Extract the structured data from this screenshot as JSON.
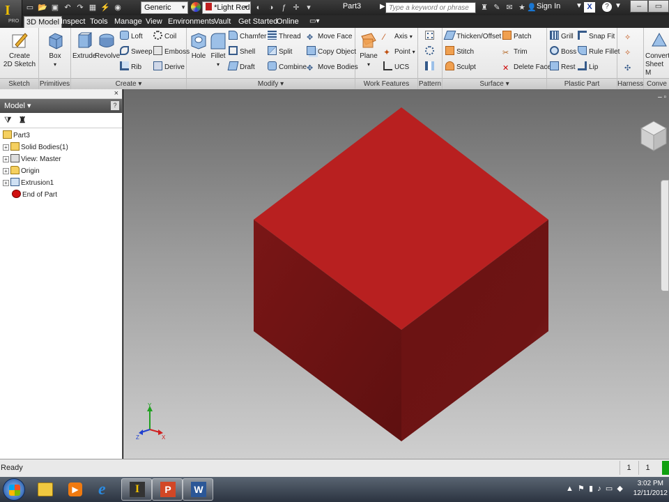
{
  "titlebar": {
    "app_logo": "I",
    "edition": "PRO",
    "material": "Generic",
    "appearance": "*Light Red",
    "document_title": "Part3",
    "search_placeholder": "Type a keyword or phrase",
    "sign_in": "Sign In",
    "help": "?"
  },
  "tabs": [
    "3D Model",
    "Inspect",
    "Tools",
    "Manage",
    "View",
    "Environments",
    "Vault",
    "Get Started",
    "Online"
  ],
  "ribbon": {
    "sketch": {
      "label": "Sketch",
      "create_2d_sketch_line1": "Create",
      "create_2d_sketch_line2": "2D Sketch"
    },
    "primitives": {
      "label": "Primitives",
      "box": "Box"
    },
    "create": {
      "label": "Create ▾",
      "extrude": "Extrude",
      "revolve": "Revolve",
      "loft": "Loft",
      "sweep": "Sweep",
      "rib": "Rib",
      "coil": "Coil",
      "emboss": "Emboss",
      "derive": "Derive"
    },
    "modify": {
      "label": "Modify ▾",
      "hole": "Hole",
      "fillet": "Fillet",
      "chamfer": "Chamfer",
      "shell": "Shell",
      "draft": "Draft",
      "thread": "Thread",
      "split": "Split",
      "combine": "Combine",
      "move_face": "Move Face",
      "copy_object": "Copy Object",
      "move_bodies": "Move Bodies"
    },
    "work_features": {
      "label": "Work Features",
      "plane": "Plane",
      "axis": "Axis",
      "point": "Point",
      "ucs": "UCS"
    },
    "pattern": {
      "label": "Pattern"
    },
    "surface": {
      "label": "Surface ▾",
      "thicken_offset": "Thicken/Offset",
      "stitch": "Stitch",
      "sculpt": "Sculpt",
      "patch": "Patch",
      "trim": "Trim",
      "delete_face": "Delete Face"
    },
    "plastic_part": {
      "label": "Plastic Part",
      "grill": "Grill",
      "boss": "Boss",
      "rest": "Rest",
      "snap_fit": "Snap Fit",
      "rule_fillet": "Rule Fillet",
      "lip": "Lip"
    },
    "harness": {
      "label": "Harness"
    },
    "convert": {
      "label": "Conve",
      "convert_line1": "Convert",
      "convert_line2": "Sheet M"
    }
  },
  "browser": {
    "close": "×",
    "header": "Model ▾",
    "help": "?",
    "tree": [
      {
        "label": "Part3",
        "expand": ""
      },
      {
        "label": "Solid Bodies(1)",
        "expand": "+"
      },
      {
        "label": "View: Master",
        "expand": "+"
      },
      {
        "label": "Origin",
        "expand": "+"
      },
      {
        "label": "Extrusion1",
        "expand": "+"
      },
      {
        "label": "End of Part",
        "expand": ""
      }
    ]
  },
  "viewport": {
    "part_color": "#b82020",
    "axis_labels": {
      "x": "X",
      "y": "Y",
      "z": "Z"
    }
  },
  "statusbar": {
    "status": "Ready",
    "count1": "1",
    "count2": "1"
  },
  "taskbar": {
    "time": "3:02 PM",
    "date": "12/11/2012"
  }
}
